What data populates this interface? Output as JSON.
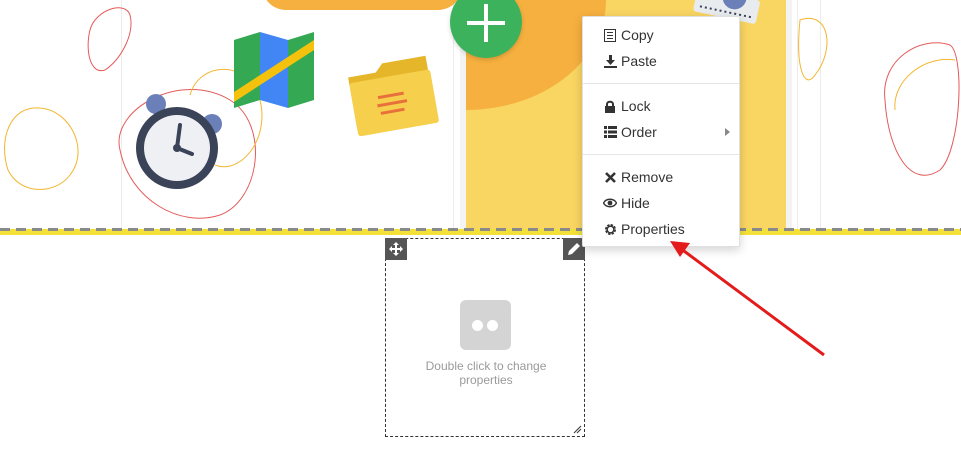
{
  "context_menu": {
    "items": [
      {
        "label": "Copy",
        "icon": "copy-icon"
      },
      {
        "label": "Paste",
        "icon": "download-icon"
      },
      {
        "label": "Lock",
        "icon": "lock-icon"
      },
      {
        "label": "Order",
        "icon": "list-icon",
        "has_submenu": true
      },
      {
        "label": "Remove",
        "icon": "close-icon"
      },
      {
        "label": "Hide",
        "icon": "eye-icon"
      },
      {
        "label": "Properties",
        "icon": "gear-icon"
      }
    ]
  },
  "placeholder": {
    "hint_text": "Double click to change properties",
    "move_handle_icon": "move-icon",
    "edit_handle_icon": "pencil-icon",
    "media_icon": "flickr-icon"
  },
  "colors": {
    "accent_green": "#3db25c",
    "card_yellow": "#f9d562",
    "card_orange": "#f6b03f",
    "guide_yellow": "#f3e13a",
    "annotation_red": "#e31b1b"
  }
}
